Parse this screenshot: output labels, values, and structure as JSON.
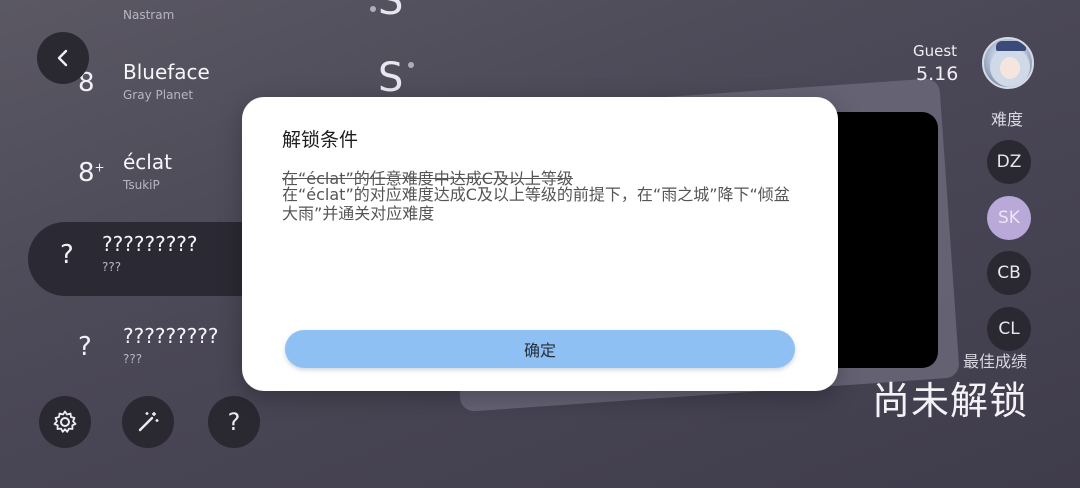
{
  "songs": [
    {
      "level": "",
      "title": "",
      "artist": "Nastram"
    },
    {
      "level": "8",
      "title": "Blueface",
      "artist": "Gray Planet"
    },
    {
      "level": "8",
      "level_sup": "+",
      "title": "éclat",
      "artist": "TsukiP"
    },
    {
      "level": "?",
      "title": "?????????",
      "artist": "???"
    },
    {
      "level": "?",
      "title": "?????????",
      "artist": "???"
    }
  ],
  "background": {
    "letter": "S"
  },
  "controls": {
    "back_icon": "chevron-left-icon",
    "settings_icon": "gear-icon",
    "magic_icon": "magic-wand-icon",
    "help_label": "?"
  },
  "player": {
    "name": "Guest",
    "rks": "5.16"
  },
  "difficulty": {
    "label": "难度",
    "options": [
      "DZ",
      "SK",
      "CB",
      "CL"
    ],
    "selected": "SK"
  },
  "best": {
    "label": "最佳成绩",
    "value": "尚未解锁"
  },
  "modal": {
    "title": "解锁条件",
    "condition_old": "在“éclat”的任意难度中达成C及以上等级",
    "condition_new": "在“éclat”的对应难度达成C及以上等级的前提下，在“雨之城”降下“倾盆大雨”并通关对应难度",
    "confirm_label": "确定"
  },
  "colors": {
    "confirm_button": "#8ec0f4",
    "selected_difficulty": "#b9a9d9",
    "dark_button": "#2a2831"
  }
}
